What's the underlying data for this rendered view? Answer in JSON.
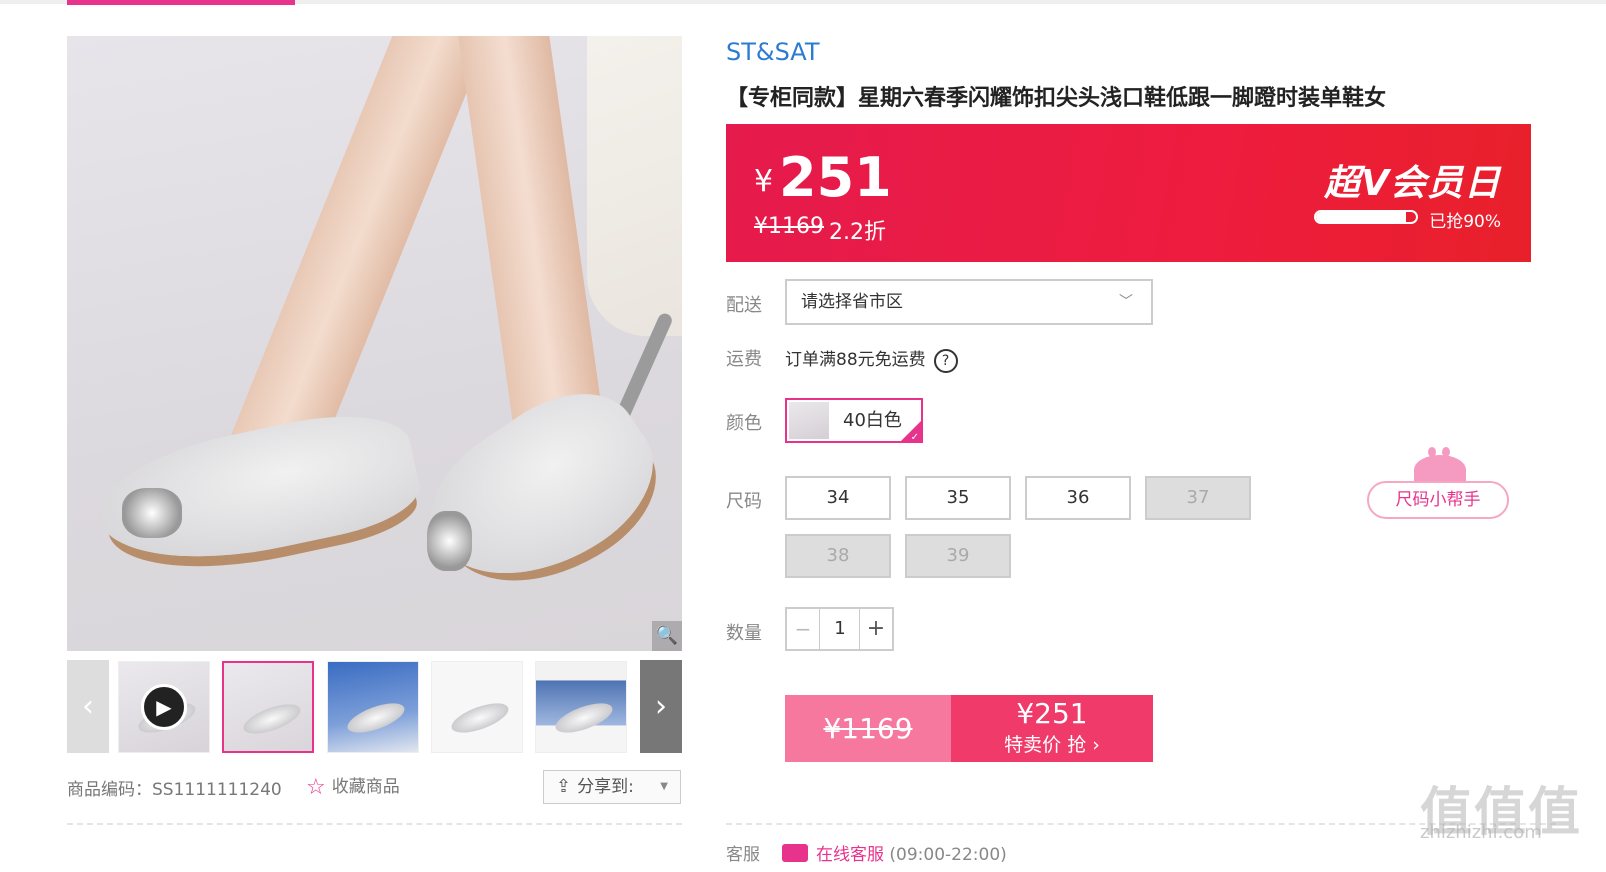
{
  "brand": "ST&SAT",
  "title": "【专柜同款】星期六春季闪耀饰扣尖头浅口鞋低跟一脚蹬时装单鞋女",
  "price": {
    "currency": "¥",
    "current": "251",
    "original": "¥1169",
    "discount": "2.2折",
    "vip_banner": "超V会员日",
    "sold_label": "已抢90%",
    "sold_fraction": 0.9
  },
  "delivery": {
    "label": "配送",
    "placeholder": "请选择省市区"
  },
  "shipping": {
    "label": "运费",
    "text": "订单满88元免运费",
    "help": "?"
  },
  "color": {
    "label": "颜色",
    "selected": "40白色"
  },
  "size": {
    "label": "尺码",
    "options": [
      {
        "value": "34",
        "available": true
      },
      {
        "value": "35",
        "available": true
      },
      {
        "value": "36",
        "available": true
      },
      {
        "value": "37",
        "available": false
      },
      {
        "value": "38",
        "available": false
      },
      {
        "value": "39",
        "available": false
      }
    ],
    "helper": "尺码小帮手"
  },
  "quantity": {
    "label": "数量",
    "value": "1",
    "minus": "−",
    "plus": "+"
  },
  "buy": {
    "original": "¥1169",
    "price": "¥251",
    "action": "特卖价 抢 ›"
  },
  "gallery": {
    "prev": "‹",
    "next": "›",
    "zoom": "🔍",
    "play": "▶"
  },
  "product_code": "商品编码：SS1111111240",
  "favorite": "收藏商品",
  "share": "分享到:",
  "service": {
    "label": "客服",
    "link": "在线客服",
    "hours": "(09:00-22:00)"
  },
  "watermark": {
    "main": "值值值",
    "sub": "zhizhizhi.com"
  },
  "colors": {
    "accent": "#e8338d",
    "price_banner": "#ee1c3e",
    "brand_link": "#2b7bd3"
  }
}
